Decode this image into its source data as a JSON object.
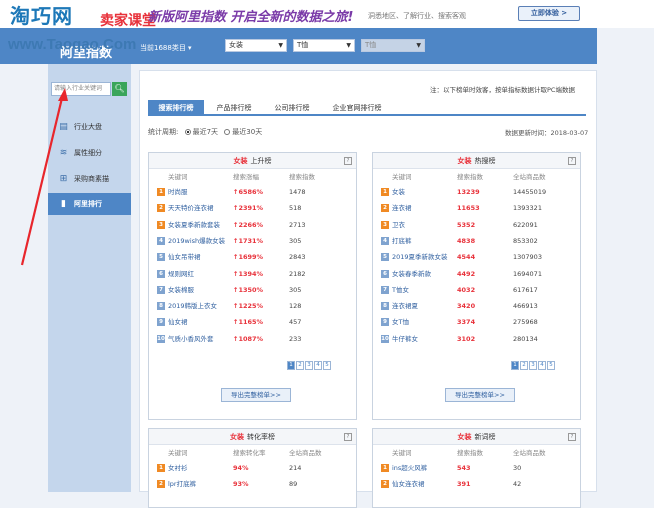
{
  "banner": {
    "logo": "淘巧网",
    "logo_sub": "卖家课堂",
    "url": "www.Taoqao.Com",
    "title": "新版阿里指数  开启全新的数据之旅!",
    "note": "洞悉地区、了解行业、搜索客观",
    "btn": "立即体验 >"
  },
  "header": {
    "title": "阿里指数",
    "cat_label": "当前1688类目 ▾",
    "sel1": "女装",
    "sel2": "T恤",
    "sel3": "T恤"
  },
  "sidebar": {
    "search_placeholder": "请输入行业关键词",
    "search_icon": "search-icon",
    "items": [
      {
        "label": "行业大盘",
        "icon": "chart-icon"
      },
      {
        "label": "属性细分",
        "icon": "layers-icon"
      },
      {
        "label": "采购商素描",
        "icon": "cart-icon"
      },
      {
        "label": "阿里排行",
        "icon": "bar-icon"
      }
    ]
  },
  "main": {
    "note": "注：以下榜单时效客，按单指标数据计取PC端数据",
    "tabs": [
      "搜索排行榜",
      "产品排行榜",
      "公司排行榜",
      "企业官网排行榜"
    ],
    "period_label": "统计周期:",
    "period_opt1": "最近7天",
    "period_opt2": "最近30天",
    "updated": "数据更新时间：2018-03-07"
  },
  "panels": [
    {
      "cat": "女装",
      "title": "上升榜",
      "cols": [
        "关键词",
        "搜索涨幅",
        "搜索指数"
      ],
      "rows": [
        {
          "rank": "1",
          "kw": "时尚服",
          "v1": "↑6586%",
          "v2": "1478"
        },
        {
          "rank": "2",
          "kw": "天天特价连衣裙",
          "v1": "↑2391%",
          "v2": "518"
        },
        {
          "rank": "3",
          "kw": "女装夏季新款套装",
          "v1": "↑2266%",
          "v2": "2713"
        },
        {
          "rank": "4",
          "kw": "2019wish爆款女装",
          "v1": "↑1731%",
          "v2": "305"
        },
        {
          "rank": "5",
          "kw": "仙女吊带裙",
          "v1": "↑1699%",
          "v2": "2843"
        },
        {
          "rank": "6",
          "kw": "规则网红",
          "v1": "↑1394%",
          "v2": "2182"
        },
        {
          "rank": "7",
          "kw": "女装棉服",
          "v1": "↑1350%",
          "v2": "305"
        },
        {
          "rank": "8",
          "kw": "2019韩版上衣女",
          "v1": "↑1225%",
          "v2": "128"
        },
        {
          "rank": "9",
          "kw": "仙女裙",
          "v1": "↑1165%",
          "v2": "457"
        },
        {
          "rank": "10",
          "kw": "气质小香风外套",
          "v1": "↑1087%",
          "v2": "233"
        }
      ],
      "pages": [
        "1",
        "2",
        "3",
        "4",
        "5"
      ],
      "export": "导出完整榜单>>"
    },
    {
      "cat": "女装",
      "title": "热搜榜",
      "cols": [
        "关键词",
        "搜索指数",
        "全站商品数"
      ],
      "rows": [
        {
          "rank": "1",
          "kw": "女装",
          "v1": "13239",
          "v2": "14455019"
        },
        {
          "rank": "2",
          "kw": "连衣裙",
          "v1": "11653",
          "v2": "1393321"
        },
        {
          "rank": "3",
          "kw": "卫衣",
          "v1": "5352",
          "v2": "622091"
        },
        {
          "rank": "4",
          "kw": "打底裤",
          "v1": "4838",
          "v2": "853302"
        },
        {
          "rank": "5",
          "kw": "2019夏季新款女装",
          "v1": "4544",
          "v2": "1307903"
        },
        {
          "rank": "6",
          "kw": "女装春季新款",
          "v1": "4492",
          "v2": "1694071"
        },
        {
          "rank": "7",
          "kw": "T恤女",
          "v1": "4032",
          "v2": "617617"
        },
        {
          "rank": "8",
          "kw": "连衣裙夏",
          "v1": "3420",
          "v2": "466913"
        },
        {
          "rank": "9",
          "kw": "女T恤",
          "v1": "3374",
          "v2": "275968"
        },
        {
          "rank": "10",
          "kw": "牛仔裤女",
          "v1": "3102",
          "v2": "280134"
        }
      ],
      "pages": [
        "1",
        "2",
        "3",
        "4",
        "5"
      ],
      "export": "导出完整榜单>>"
    },
    {
      "cat": "女装",
      "title": "转化率榜",
      "cols": [
        "关键词",
        "搜索转化率",
        "全站商品数"
      ],
      "rows": [
        {
          "rank": "1",
          "kw": "女衬衫",
          "v1": "94%",
          "v2": "214"
        },
        {
          "rank": "2",
          "kw": "lpr打底裤",
          "v1": "93%",
          "v2": "89"
        }
      ]
    },
    {
      "cat": "女装",
      "title": "新词榜",
      "cols": [
        "关键词",
        "搜索指数",
        "全站商品数"
      ],
      "rows": [
        {
          "rank": "1",
          "kw": "ins超火风裤",
          "v1": "543",
          "v2": "30"
        },
        {
          "rank": "2",
          "kw": "仙女连衣裙",
          "v1": "391",
          "v2": "42"
        }
      ]
    }
  ]
}
